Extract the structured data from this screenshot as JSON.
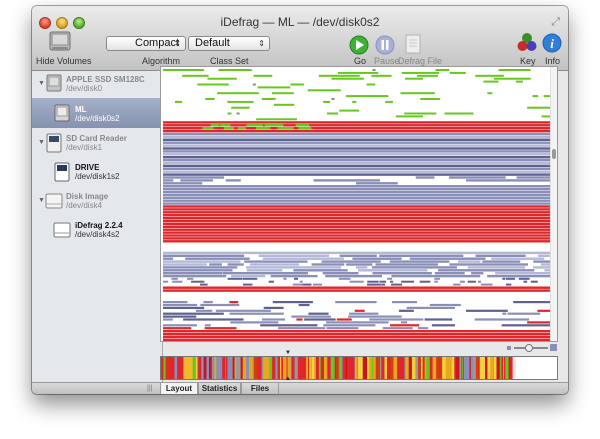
{
  "window": {
    "title": "iDefrag — ML — /dev/disk0s2"
  },
  "toolbar": {
    "hide_volumes_label": "Hide Volumes",
    "algorithm_value": "Compact",
    "algorithm_label": "Algorithm",
    "class_set_value": "Default",
    "class_set_label": "Class Set",
    "go_label": "Go",
    "pause_label": "Pause",
    "defrag_file_label": "Defrag File",
    "key_label": "Key",
    "info_label": "Info"
  },
  "sidebar": {
    "devices": [
      {
        "name": "APPLE SSD SM128C",
        "path": "/dev/disk0",
        "volumes": [
          {
            "name": "ML",
            "path": "/dev/disk0s2",
            "selected": true
          }
        ]
      },
      {
        "name": "SD Card Reader",
        "path": "/dev/disk1",
        "volumes": [
          {
            "name": "DRIVE",
            "path": "/dev/disk1s2",
            "selected": false
          }
        ]
      },
      {
        "name": "Disk Image",
        "path": "/dev/disk4",
        "volumes": [
          {
            "name": "iDefrag 2.2.4",
            "path": "/dev/disk4s2",
            "selected": false
          }
        ]
      }
    ]
  },
  "tabs": [
    {
      "label": "Layout",
      "active": true
    },
    {
      "label": "Statistics",
      "active": false
    },
    {
      "label": "Files",
      "active": false
    }
  ],
  "colors": {
    "fragmented": "#e0262a",
    "metadata": "#8a8fb8",
    "green": "#66c71c",
    "selection": "#8593b0"
  }
}
